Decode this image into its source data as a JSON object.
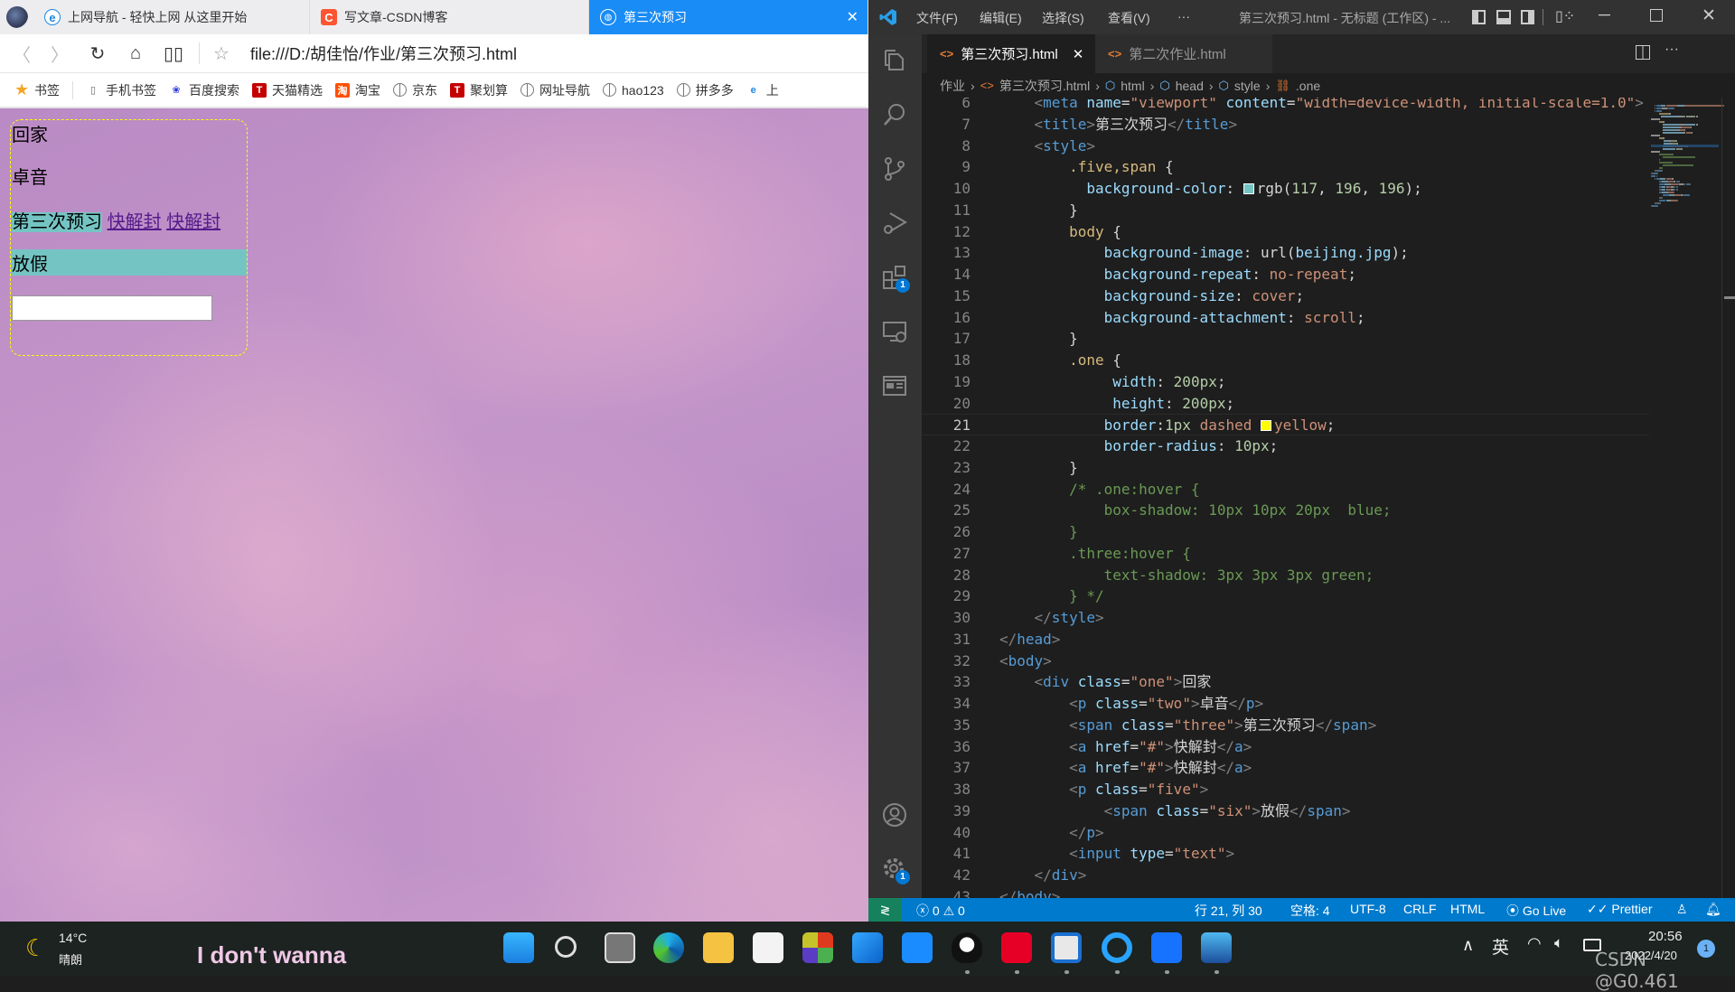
{
  "browser": {
    "tabs": [
      {
        "label": "上网导航 - 轻快上网 从这里开始",
        "icon": "ie-icon"
      },
      {
        "label": "写文章-CSDN博客",
        "icon": "csdn-icon"
      },
      {
        "label": "第三次预习",
        "icon": "globe-icon",
        "active": true
      }
    ],
    "url": "file:///D:/胡佳怡/作业/第三次预习.html",
    "bookmarks": [
      {
        "label": "书签",
        "icon": "star-icon"
      },
      {
        "label": "手机书签",
        "icon": "phone-icon"
      },
      {
        "label": "百度搜索",
        "icon": "baidu-icon"
      },
      {
        "label": "天猫精选",
        "icon": "tmall-icon"
      },
      {
        "label": "淘宝",
        "icon": "taobao-icon"
      },
      {
        "label": "京东",
        "icon": "globe-icon"
      },
      {
        "label": "聚划算",
        "icon": "juhuasuan-icon"
      },
      {
        "label": "网址导航",
        "icon": "globe-icon"
      },
      {
        "label": "hao123",
        "icon": "globe-icon"
      },
      {
        "label": "拼多多",
        "icon": "globe-icon"
      },
      {
        "label": "上",
        "icon": "ie-icon"
      }
    ],
    "page": {
      "div_text": "回家",
      "p_two": "卓音",
      "span_three": "第三次预习",
      "links": [
        "快解封",
        "快解封"
      ],
      "p_five": "放假",
      "input_value": "",
      "teal": "#75c4c4",
      "border": "#ffff00"
    }
  },
  "vscode": {
    "menus": [
      "文件(F)",
      "编辑(E)",
      "选择(S)",
      "查看(V)",
      "···"
    ],
    "title": "第三次预习.html - 无标题 (工作区) - ...",
    "tabs": [
      {
        "label": "第三次预习.html",
        "active": true
      },
      {
        "label": "第二次作业.html",
        "active": false
      }
    ],
    "breadcrumb": [
      "作业",
      "第三次预习.html",
      "html",
      "head",
      "style",
      ".one"
    ],
    "activity_badges": {
      "extensions": "1",
      "settings": "1"
    },
    "current_line": 21,
    "code": [
      [
        6,
        [
          [
            "pu",
            "    "
          ],
          [
            "b",
            "<"
          ],
          [
            "tg",
            "meta "
          ],
          [
            "at",
            "name"
          ],
          [
            "pu",
            "="
          ],
          [
            "s",
            "\"viewport\" "
          ],
          [
            "at",
            "content"
          ],
          [
            "pu",
            "="
          ],
          [
            "s",
            "\"width=device-width, initial-scale=1.0\""
          ],
          [
            "b",
            ">"
          ]
        ]
      ],
      [
        7,
        [
          [
            "pu",
            "    "
          ],
          [
            "b",
            "<"
          ],
          [
            "tg",
            "title"
          ],
          [
            "b",
            ">"
          ],
          [
            "tx",
            "第三次预习"
          ],
          [
            "b",
            "</"
          ],
          [
            "tg",
            "title"
          ],
          [
            "b",
            ">"
          ]
        ]
      ],
      [
        8,
        [
          [
            "pu",
            "    "
          ],
          [
            "b",
            "<"
          ],
          [
            "tg",
            "style"
          ],
          [
            "b",
            ">"
          ]
        ]
      ],
      [
        9,
        [
          [
            "pu",
            "        "
          ],
          [
            "sel",
            ".five,span"
          ],
          [
            "pu",
            " {"
          ]
        ]
      ],
      [
        10,
        [
          [
            "pu",
            "          "
          ],
          [
            "p",
            "background-color"
          ],
          [
            "pu",
            ": "
          ],
          [
            "sw",
            "#75c4c4"
          ],
          [
            "pu",
            "rgb("
          ],
          [
            "n",
            "117"
          ],
          [
            "pu",
            ", "
          ],
          [
            "n",
            "196"
          ],
          [
            "pu",
            ", "
          ],
          [
            "n",
            "196"
          ],
          [
            "pu",
            ");"
          ]
        ]
      ],
      [
        11,
        [
          [
            "pu",
            "        }"
          ]
        ]
      ],
      [
        12,
        [
          [
            "pu",
            "        "
          ],
          [
            "sel",
            "body"
          ],
          [
            "pu",
            " {"
          ]
        ]
      ],
      [
        13,
        [
          [
            "pu",
            "            "
          ],
          [
            "p",
            "background-image"
          ],
          [
            "pu",
            ": "
          ],
          [
            "pu",
            "url("
          ],
          [
            "at",
            "beijing.jpg"
          ],
          [
            "pu",
            ");"
          ]
        ]
      ],
      [
        14,
        [
          [
            "pu",
            "            "
          ],
          [
            "p",
            "background-repeat"
          ],
          [
            "pu",
            ": "
          ],
          [
            "v",
            "no-repeat"
          ],
          [
            "pu",
            ";"
          ]
        ]
      ],
      [
        15,
        [
          [
            "pu",
            "            "
          ],
          [
            "p",
            "background-size"
          ],
          [
            "pu",
            ": "
          ],
          [
            "v",
            "cover"
          ],
          [
            "pu",
            ";"
          ]
        ]
      ],
      [
        16,
        [
          [
            "pu",
            "            "
          ],
          [
            "p",
            "background-attachment"
          ],
          [
            "pu",
            ": "
          ],
          [
            "v",
            "scroll"
          ],
          [
            "pu",
            ";"
          ]
        ]
      ],
      [
        17,
        [
          [
            "pu",
            "        }"
          ]
        ]
      ],
      [
        18,
        [
          [
            "pu",
            "        "
          ],
          [
            "sel",
            ".one"
          ],
          [
            "pu",
            " {"
          ]
        ]
      ],
      [
        19,
        [
          [
            "pu",
            "             "
          ],
          [
            "p",
            "width"
          ],
          [
            "pu",
            ": "
          ],
          [
            "n",
            "200px"
          ],
          [
            "pu",
            ";"
          ]
        ]
      ],
      [
        20,
        [
          [
            "pu",
            "             "
          ],
          [
            "p",
            "height"
          ],
          [
            "pu",
            ": "
          ],
          [
            "n",
            "200px"
          ],
          [
            "pu",
            ";"
          ]
        ]
      ],
      [
        21,
        [
          [
            "pu",
            "            "
          ],
          [
            "p",
            "border"
          ],
          [
            "pu",
            ":"
          ],
          [
            "n",
            "1px "
          ],
          [
            "v",
            "dashed "
          ],
          [
            "sw",
            "#ffff00"
          ],
          [
            "v",
            "yellow"
          ],
          [
            "pu",
            ";"
          ]
        ]
      ],
      [
        22,
        [
          [
            "pu",
            "            "
          ],
          [
            "p",
            "border-radius"
          ],
          [
            "pu",
            ": "
          ],
          [
            "n",
            "10px"
          ],
          [
            "pu",
            ";"
          ]
        ]
      ],
      [
        23,
        [
          [
            "pu",
            "        }"
          ]
        ]
      ],
      [
        24,
        [
          [
            "pu",
            "        "
          ],
          [
            "c",
            "/* .one:hover {"
          ]
        ]
      ],
      [
        25,
        [
          [
            "pu",
            "            "
          ],
          [
            "c",
            "box-shadow: 10px 10px 20px  blue;"
          ]
        ]
      ],
      [
        26,
        [
          [
            "pu",
            "        "
          ],
          [
            "c",
            "}"
          ]
        ]
      ],
      [
        27,
        [
          [
            "pu",
            "        "
          ],
          [
            "c",
            ".three:hover {"
          ]
        ]
      ],
      [
        28,
        [
          [
            "pu",
            "            "
          ],
          [
            "c",
            "text-shadow: 3px 3px 3px green;"
          ]
        ]
      ],
      [
        29,
        [
          [
            "pu",
            "        "
          ],
          [
            "c",
            "} */"
          ]
        ]
      ],
      [
        30,
        [
          [
            "pu",
            "    "
          ],
          [
            "b",
            "</"
          ],
          [
            "tg",
            "style"
          ],
          [
            "b",
            ">"
          ]
        ]
      ],
      [
        31,
        [
          [
            "b",
            "</"
          ],
          [
            "tg",
            "head"
          ],
          [
            "b",
            ">"
          ]
        ]
      ],
      [
        32,
        [
          [
            "b",
            "<"
          ],
          [
            "tg",
            "body"
          ],
          [
            "b",
            ">"
          ]
        ]
      ],
      [
        33,
        [
          [
            "pu",
            "    "
          ],
          [
            "b",
            "<"
          ],
          [
            "tg",
            "div "
          ],
          [
            "at",
            "class"
          ],
          [
            "pu",
            "="
          ],
          [
            "s",
            "\"one\""
          ],
          [
            "b",
            ">"
          ],
          [
            "tx",
            "回家"
          ]
        ]
      ],
      [
        34,
        [
          [
            "pu",
            "        "
          ],
          [
            "b",
            "<"
          ],
          [
            "tg",
            "p "
          ],
          [
            "at",
            "class"
          ],
          [
            "pu",
            "="
          ],
          [
            "s",
            "\"two\""
          ],
          [
            "b",
            ">"
          ],
          [
            "tx",
            "卓音"
          ],
          [
            "b",
            "</"
          ],
          [
            "tg",
            "p"
          ],
          [
            "b",
            ">"
          ]
        ]
      ],
      [
        35,
        [
          [
            "pu",
            "        "
          ],
          [
            "b",
            "<"
          ],
          [
            "tg",
            "span "
          ],
          [
            "at",
            "class"
          ],
          [
            "pu",
            "="
          ],
          [
            "s",
            "\"three\""
          ],
          [
            "b",
            ">"
          ],
          [
            "tx",
            "第三次预习"
          ],
          [
            "b",
            "</"
          ],
          [
            "tg",
            "span"
          ],
          [
            "b",
            ">"
          ]
        ]
      ],
      [
        36,
        [
          [
            "pu",
            "        "
          ],
          [
            "b",
            "<"
          ],
          [
            "tg",
            "a "
          ],
          [
            "at",
            "href"
          ],
          [
            "pu",
            "="
          ],
          [
            "s",
            "\"#\""
          ],
          [
            "b",
            ">"
          ],
          [
            "tx",
            "快解封"
          ],
          [
            "b",
            "</"
          ],
          [
            "tg",
            "a"
          ],
          [
            "b",
            ">"
          ]
        ]
      ],
      [
        37,
        [
          [
            "pu",
            "        "
          ],
          [
            "b",
            "<"
          ],
          [
            "tg",
            "a "
          ],
          [
            "at",
            "href"
          ],
          [
            "pu",
            "="
          ],
          [
            "s",
            "\"#\""
          ],
          [
            "b",
            ">"
          ],
          [
            "tx",
            "快解封"
          ],
          [
            "b",
            "</"
          ],
          [
            "tg",
            "a"
          ],
          [
            "b",
            ">"
          ]
        ]
      ],
      [
        38,
        [
          [
            "pu",
            "        "
          ],
          [
            "b",
            "<"
          ],
          [
            "tg",
            "p "
          ],
          [
            "at",
            "class"
          ],
          [
            "pu",
            "="
          ],
          [
            "s",
            "\"five\""
          ],
          [
            "b",
            ">"
          ]
        ]
      ],
      [
        39,
        [
          [
            "pu",
            "            "
          ],
          [
            "b",
            "<"
          ],
          [
            "tg",
            "span "
          ],
          [
            "at",
            "class"
          ],
          [
            "pu",
            "="
          ],
          [
            "s",
            "\"six\""
          ],
          [
            "b",
            ">"
          ],
          [
            "tx",
            "放假"
          ],
          [
            "b",
            "</"
          ],
          [
            "tg",
            "span"
          ],
          [
            "b",
            ">"
          ]
        ]
      ],
      [
        40,
        [
          [
            "pu",
            "        "
          ],
          [
            "b",
            "</"
          ],
          [
            "tg",
            "p"
          ],
          [
            "b",
            ">"
          ]
        ]
      ],
      [
        41,
        [
          [
            "pu",
            "        "
          ],
          [
            "b",
            "<"
          ],
          [
            "tg",
            "input "
          ],
          [
            "at",
            "type"
          ],
          [
            "pu",
            "="
          ],
          [
            "s",
            "\"text\""
          ],
          [
            "b",
            ">"
          ]
        ]
      ],
      [
        42,
        [
          [
            "pu",
            "    "
          ],
          [
            "b",
            "</"
          ],
          [
            "tg",
            "div"
          ],
          [
            "b",
            ">"
          ]
        ]
      ],
      [
        43,
        [
          [
            "b",
            "</"
          ],
          [
            "tg",
            "body"
          ],
          [
            "b",
            ">"
          ]
        ]
      ]
    ],
    "status": {
      "errors": "0",
      "warnings": "0",
      "position": "行 21, 列 30",
      "spaces": "空格: 4",
      "encoding": "UTF-8",
      "eol": "CRLF",
      "language": "HTML",
      "golive": "Go Live",
      "prettier": "Prettier"
    },
    "colors": {
      "statusbar": "#007acc",
      "remote": "#16825d",
      "activitybar": "#333333",
      "editor": "#1e1e1e"
    }
  },
  "taskbar": {
    "weather": {
      "temp": "14°C",
      "desc": "晴朗",
      "icon": "moon-icon"
    },
    "media_text": "I don't wanna",
    "apps": [
      "windows-start-icon",
      "search-icon",
      "task-view-icon",
      "edge-icon",
      "file-explorer-icon",
      "store-icon",
      "office-icon",
      "mail-icon",
      "dingtalk-icon",
      "qq-icon",
      "netease-music-icon",
      "browser-window-icon",
      "qq-browser-icon",
      "lanhu-icon",
      "photos-icon"
    ],
    "tray": {
      "ime": "英",
      "time": "20:56",
      "date": "2022/4/20",
      "notifications": "1"
    },
    "watermark": "CSDN @G0.461"
  }
}
